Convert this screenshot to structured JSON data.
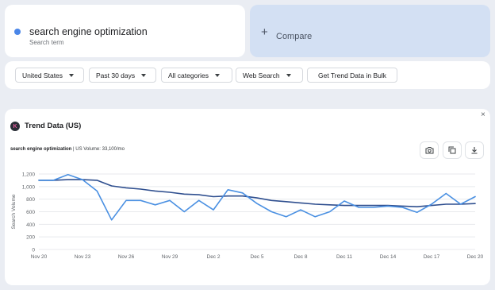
{
  "term": {
    "title": "search engine optimization",
    "subtitle": "Search term",
    "dot_color": "#4a86e8"
  },
  "compare": {
    "plus": "+",
    "label": "Compare"
  },
  "filters": {
    "country": "United States",
    "period": "Past 30 days",
    "category": "All categories",
    "search_type": "Web Search",
    "bulk": "Get Trend Data in Bulk"
  },
  "trend": {
    "close": "×",
    "logo": "K",
    "title": "Trend Data (US)",
    "term_label": "search engine optimization",
    "volume_text": " | US Volume: 33,100/mo",
    "icons": [
      "camera-icon",
      "copy-icon",
      "download-icon"
    ]
  },
  "chart_data": {
    "type": "line",
    "ylabel": "Search Volume",
    "ylim": [
      0,
      1200
    ],
    "yticks": [
      0,
      200,
      400,
      600,
      800,
      1000,
      1200
    ],
    "ytick_labels": [
      "0",
      "200",
      "400",
      "600",
      "800",
      "1,000",
      "1,200"
    ],
    "x_labels": [
      "Nov 20",
      "Nov 23",
      "Nov 26",
      "Nov 29",
      "Dec 2",
      "Dec 5",
      "Dec 8",
      "Dec 11",
      "Dec 14",
      "Dec 17",
      "Dec 20"
    ],
    "grid": true,
    "series": [
      {
        "color": "#4a90e2",
        "values": [
          1100,
          1100,
          1190,
          1110,
          930,
          470,
          780,
          780,
          710,
          780,
          600,
          780,
          630,
          950,
          900,
          730,
          600,
          520,
          630,
          520,
          600,
          770,
          670,
          670,
          690,
          670,
          590,
          720,
          890,
          720,
          840
        ]
      },
      {
        "color": "#2f4f8f",
        "values": [
          1100,
          1100,
          1110,
          1110,
          1100,
          1010,
          980,
          960,
          930,
          910,
          880,
          870,
          840,
          850,
          850,
          820,
          780,
          760,
          740,
          720,
          710,
          700,
          700,
          700,
          700,
          690,
          680,
          700,
          720,
          720,
          730
        ]
      }
    ]
  }
}
